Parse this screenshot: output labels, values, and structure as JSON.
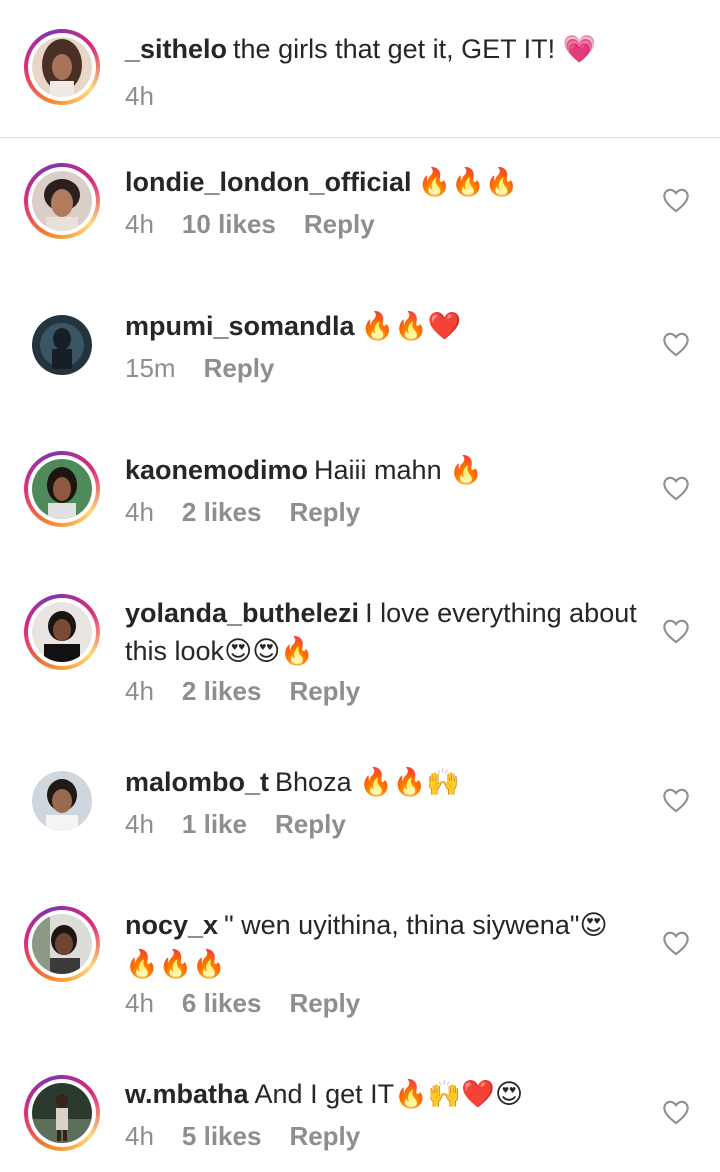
{
  "caption": {
    "username": "_sithelo",
    "text": "the girls that get it, GET IT!",
    "emoji": "💗",
    "time": "4h"
  },
  "comments": [
    {
      "username": "londie_london_official",
      "text": "",
      "emoji": "🔥🔥🔥",
      "time": "4h",
      "likes": "10 likes",
      "reply": "Reply"
    },
    {
      "username": "mpumi_somandla",
      "text": "",
      "emoji": "🔥🔥❤️",
      "time": "15m",
      "likes": "",
      "reply": "Reply"
    },
    {
      "username": "kaonemodimo",
      "text": "Haiii mahn",
      "emoji": "🔥",
      "time": "4h",
      "likes": "2 likes",
      "reply": "Reply"
    },
    {
      "username": "yolanda_buthelezi",
      "text": "I love everything about this look",
      "emoji": "😍😍🔥",
      "time": "4h",
      "likes": "2 likes",
      "reply": "Reply"
    },
    {
      "username": "malombo_t",
      "text": "Bhoza",
      "emoji": "🔥🔥🙌",
      "time": "4h",
      "likes": "1 like",
      "reply": "Reply"
    },
    {
      "username": "nocy_x",
      "text": "\" wen uyithina, thina siywena\"",
      "emoji": "😍🔥🔥🔥",
      "time": "4h",
      "likes": "6 likes",
      "reply": "Reply"
    },
    {
      "username": "w.mbatha",
      "text": "And I get IT",
      "emoji": "🔥🙌❤️😍",
      "time": "4h",
      "likes": "5 likes",
      "reply": "Reply"
    }
  ],
  "icons": {
    "like": "heart-outline-icon"
  },
  "colors": {
    "text": "#262626",
    "meta": "#8e8e8e",
    "ring": "#dd2a7b"
  }
}
